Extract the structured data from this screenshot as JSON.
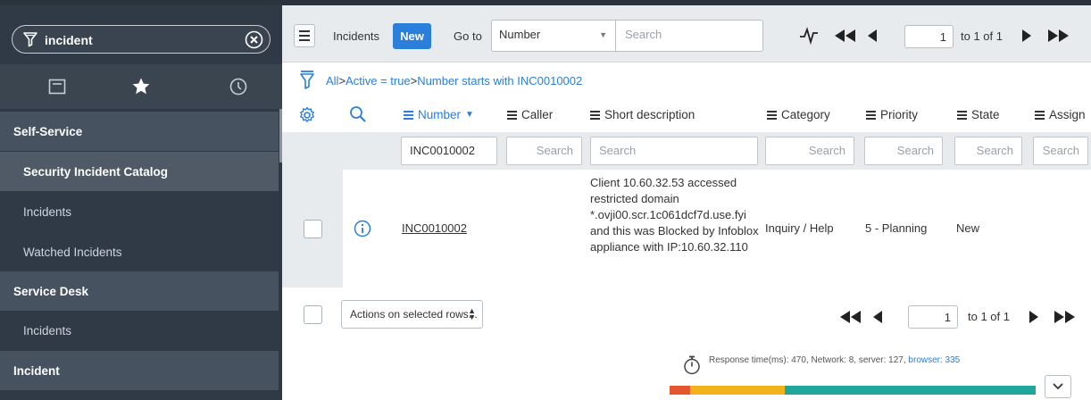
{
  "nav": {
    "search_value": "incident",
    "icons": [
      "filter-icon",
      "clear-icon",
      "all-apps-icon",
      "favorites-star-icon",
      "history-clock-icon"
    ],
    "sections": [
      {
        "type": "header",
        "label": "Self-Service"
      },
      {
        "type": "item",
        "label": "Security Incident Catalog",
        "active": true
      },
      {
        "type": "item",
        "label": "Incidents"
      },
      {
        "type": "item",
        "label": "Watched Incidents"
      },
      {
        "type": "header",
        "label": "Service Desk"
      },
      {
        "type": "item",
        "label": "Incidents"
      },
      {
        "type": "header",
        "label": "Incident"
      }
    ]
  },
  "toolbar": {
    "title": "Incidents",
    "new_label": "New",
    "goto_label": "Go to",
    "field_select": "Number",
    "search_placeholder": "Search",
    "page_input": "1",
    "page_text": "to 1 of 1"
  },
  "breadcrumb": {
    "all": "All",
    "sep": ">",
    "crumb1": "Active = true",
    "crumb2": "Number starts with INC0010002"
  },
  "columns": {
    "number": "Number",
    "caller": "Caller",
    "short_description": "Short description",
    "category": "Category",
    "priority": "Priority",
    "state": "State",
    "assigned": "Assign"
  },
  "search_row": {
    "number_value": "INC0010002",
    "placeholder": "Search"
  },
  "rows": [
    {
      "number": "INC0010002",
      "short_description": "Client 10.60.32.53 accessed restricted domain *.ovji00.scr.1c061dcf7d.use.fyi and this was Blocked by Infoblox appliance with IP:10.60.32.110",
      "category": "Inquiry / Help",
      "priority": "5 - Planning",
      "state": "New"
    }
  ],
  "footer": {
    "actions_label": "Actions on selected rows...",
    "page_input": "1",
    "page_text": "to 1 of 1"
  },
  "response": {
    "text": "Response time(ms): 470, Network: 8, server: 127,",
    "browser_link": "browser: 335",
    "segments": [
      {
        "label": "network",
        "ms": 8,
        "color": "#e4562e"
      },
      {
        "label": "server",
        "ms": 127,
        "color": "#f2b21c"
      },
      {
        "label": "browser",
        "ms": 335,
        "color": "#1fa79b"
      }
    ]
  },
  "colors": {
    "nav_bg": "#303a46",
    "accent_blue": "#2b7ed9",
    "toolbar_bg": "#e8ebee"
  }
}
